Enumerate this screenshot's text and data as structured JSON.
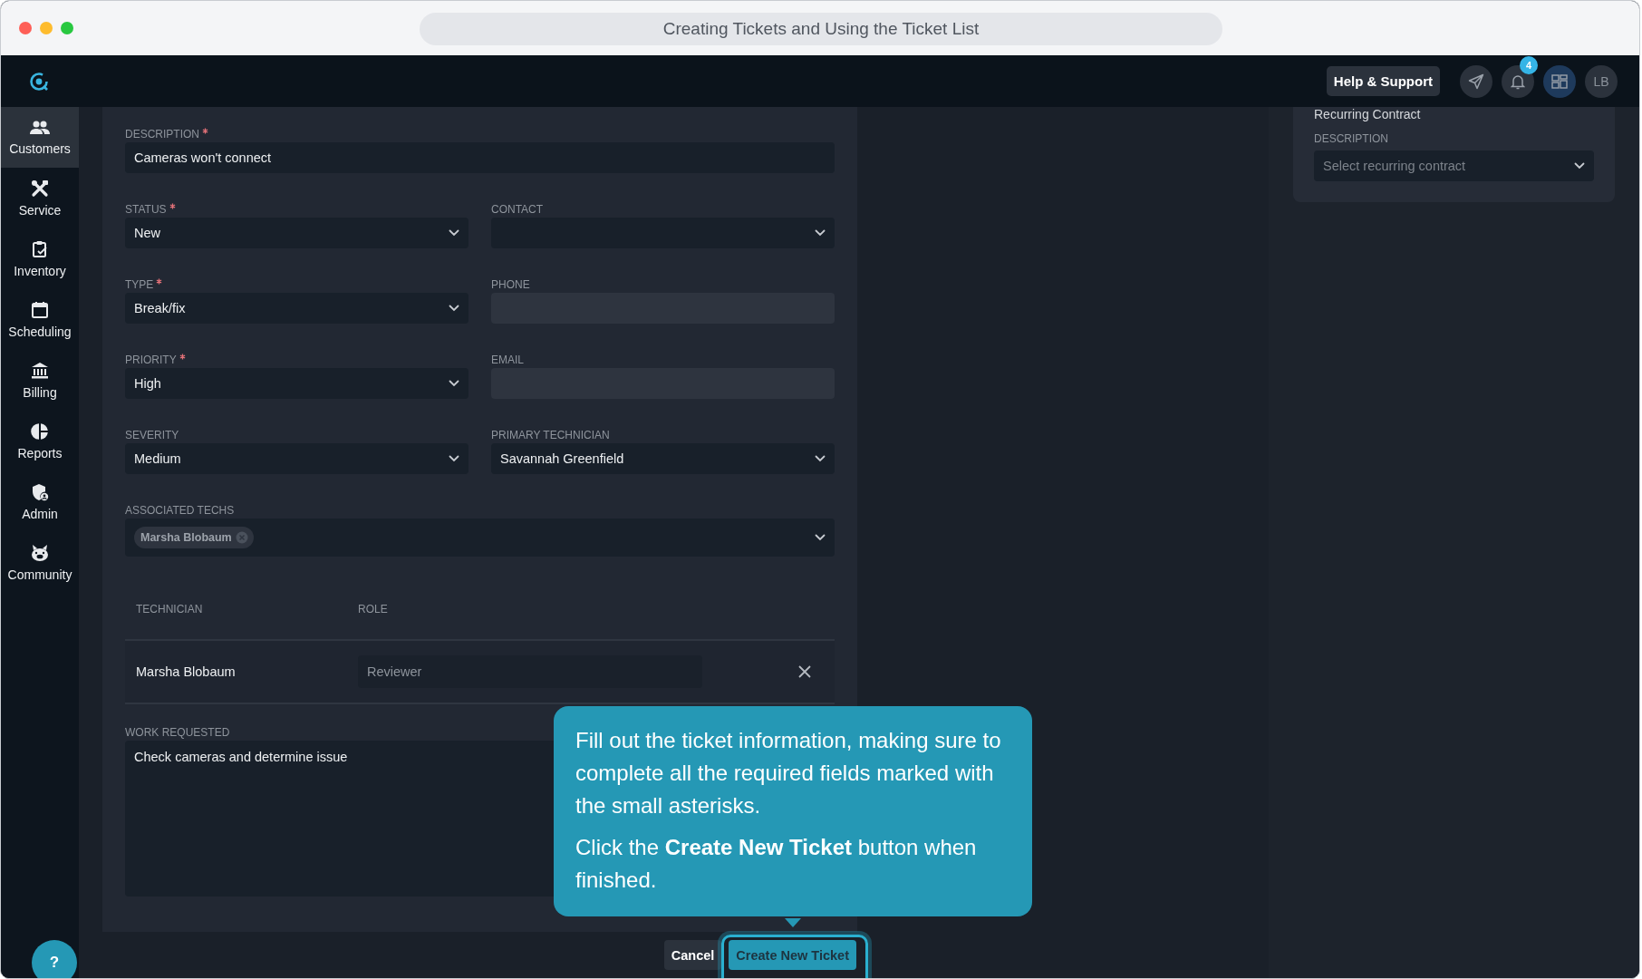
{
  "window": {
    "title": "Creating Tickets and Using the Ticket List"
  },
  "header": {
    "help_button": "Help & Support",
    "notification_count": "4",
    "avatar_initials": "LB"
  },
  "sidebar": {
    "items": [
      {
        "label": "Customers",
        "kind": "customers",
        "selected": true
      },
      {
        "label": "Service",
        "kind": "service",
        "selected": false
      },
      {
        "label": "Inventory",
        "kind": "inventory",
        "selected": false
      },
      {
        "label": "Scheduling",
        "kind": "scheduling",
        "selected": false
      },
      {
        "label": "Billing",
        "kind": "billing",
        "selected": false
      },
      {
        "label": "Reports",
        "kind": "reports",
        "selected": false
      },
      {
        "label": "Admin",
        "kind": "admin",
        "selected": false
      },
      {
        "label": "Community",
        "kind": "community",
        "selected": false
      }
    ]
  },
  "form": {
    "description": {
      "label": "DESCRIPTION",
      "required": true,
      "kind": "text",
      "value": "Cameras won't connect"
    },
    "left_fields": [
      {
        "label": "STATUS",
        "required": true,
        "kind": "select",
        "value": "New"
      },
      {
        "label": "TYPE",
        "required": true,
        "kind": "select",
        "value": "Break/fix"
      },
      {
        "label": "PRIORITY",
        "required": true,
        "kind": "select",
        "value": "High"
      },
      {
        "label": "SEVERITY",
        "required": false,
        "kind": "select",
        "value": "Medium"
      }
    ],
    "right_fields": [
      {
        "label": "CONTACT",
        "required": false,
        "kind": "select"
      },
      {
        "label": "PHONE",
        "required": false,
        "kind": "readonly"
      },
      {
        "label": "EMAIL",
        "required": false,
        "kind": "readonly"
      },
      {
        "label": "PRIMARY TECHNICIAN",
        "required": false,
        "kind": "select",
        "value": "Savannah Greenfield"
      }
    ],
    "associated_techs": {
      "label": "ASSOCIATED TECHS",
      "chips": [
        "Marsha Blobaum"
      ]
    },
    "tech_table": {
      "columns": [
        "TECHNICIAN",
        "ROLE"
      ],
      "rows": [
        {
          "technician": "Marsha Blobaum",
          "role_placeholder": "Reviewer"
        }
      ]
    },
    "work_requested": {
      "label": "WORK REQUESTED",
      "value": "Check cameras and determine issue"
    }
  },
  "side_panel": {
    "heading": "Recurring Contract",
    "label": "DESCRIPTION",
    "placeholder": "Select recurring contract"
  },
  "footer": {
    "cancel": "Cancel",
    "create": "Create New Ticket",
    "create_highlighted": true
  },
  "tooltip": {
    "paragraphs": [
      "Fill out the ticket information, making sure to complete all the required fields marked with the small asterisks.",
      "Click the **Create New Ticket** button when finished."
    ]
  },
  "help_fab": "?"
}
